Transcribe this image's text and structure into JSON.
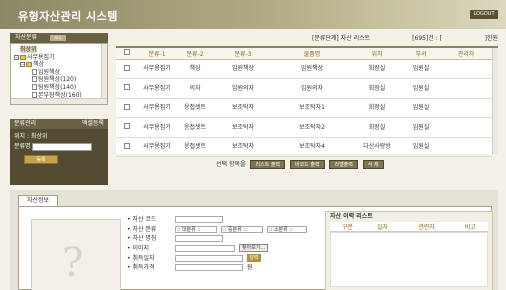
{
  "header": {
    "title": "유형자산관리 시스템",
    "logout": "LOGOUT"
  },
  "tree": {
    "title": "자산분류",
    "all_label": "ALL",
    "items": [
      {
        "label": "최상위",
        "selected": true
      },
      {
        "label": "사무용집기"
      },
      {
        "label": "책상"
      },
      {
        "label": "임원책상"
      },
      {
        "label": "팀원책상(120)"
      },
      {
        "label": "팀원책상(140)"
      },
      {
        "label": "본부장책상(160)"
      }
    ]
  },
  "mgmt": {
    "title": "분류관리",
    "extra": "엑셀등록",
    "location_label": "위치 : 최상위",
    "name_label": "분류명",
    "name_value": "",
    "register_button": "등록"
  },
  "list_header": {
    "path": "[분류단계] 자산 리스트",
    "total": "[695]건 : [",
    "end": "]한원"
  },
  "grid": {
    "columns": [
      "분류-1",
      "분류-2",
      "분류-3",
      "물품명",
      "위치",
      "부서",
      "관리자"
    ],
    "rows": [
      [
        "사무용집기",
        "책상",
        "임원책상",
        "임원책상",
        "회장실",
        "임원실",
        ""
      ],
      [
        "사무용집기",
        "의자",
        "임원의자",
        "임원의자",
        "회장실",
        "임원실",
        ""
      ],
      [
        "사무용집기",
        "응접셋트",
        "보조탁자",
        "보조탁자1",
        "회장실",
        "임원실",
        ""
      ],
      [
        "사무용집기",
        "응접셋트",
        "보조탁자",
        "보조탁자2",
        "회장실",
        "임원실",
        ""
      ],
      [
        "사무용집기",
        "응접셋트",
        "보조탁자",
        "보조탁자4",
        "다산사랑방",
        "임원실",
        ""
      ]
    ]
  },
  "actions": {
    "label": "선택 항목을",
    "buttons": [
      "리스트 출력",
      "바코드 출력",
      "라벨출력",
      "삭 제"
    ]
  },
  "asset_info": {
    "tab": "자산정보",
    "fields": {
      "code": "자산 코드",
      "class": "자산 분류",
      "name": "자산 명칭",
      "image": "이미지",
      "acquired": "취득일자",
      "price": "취득가격"
    },
    "selects": [
      ":: 대분류 ::",
      ":: 중분류 ::",
      ":: 소분류 ::"
    ],
    "find_button": "찾아보기...",
    "cal_button": "달력",
    "price_unit": "원",
    "photo_placeholder": "?"
  },
  "history": {
    "title": "자산 이력 리스트",
    "columns": [
      "구분",
      "일자",
      "관련자",
      "비고"
    ]
  }
}
